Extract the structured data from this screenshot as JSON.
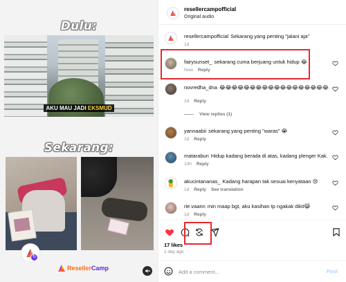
{
  "media": {
    "title_top": "Dulu:",
    "caption_top_prefix": "AKU MAU JADI ",
    "caption_top_highlight": "EKSMUD",
    "title_bottom": "Sekarang:",
    "brand_part1": "Reseller",
    "brand_part2": "Camp"
  },
  "header": {
    "account_name": "resellercampofficial",
    "audio_label": "Original audio"
  },
  "caption": {
    "username": "resellercampofficial",
    "text": "Sekarang yang penting \"jalani aja\"",
    "time": "1d"
  },
  "comments": [
    {
      "username": "fairysunset_",
      "text": "sekarang cuma berjuang untuk hidup 😂",
      "time": "Now",
      "reply": "Reply"
    },
    {
      "username": "novredha_dna",
      "text": "😂😂😂😂😂😂😂😂😂😂😂😂😂😂😂😂😂😂",
      "time": "1d",
      "reply": "Reply",
      "view_replies": "View replies (1)"
    },
    {
      "username": "yannaabii",
      "text": "sekarang yang penting \"waras\" 😭",
      "time": "1d",
      "reply": "Reply"
    },
    {
      "username": "matarabun",
      "text": "Hidup kadang berada di atas, kadang plenger Kak.",
      "time": "10h",
      "reply": "Reply"
    },
    {
      "username": "akucintananas_",
      "text": "Kadang harapan tak sesuai kenyataan 😢",
      "time": "1d",
      "reply": "Reply",
      "translate": "See translation"
    },
    {
      "username": "rie.vaann",
      "text": "min maap bgt, aku kasihan tp ngakak dikit😹",
      "time": "1d",
      "reply": "Reply"
    }
  ],
  "footer": {
    "likes": "17 likes",
    "time_ago": "1 day ago",
    "add_comment_placeholder": "Add a comment...",
    "post_label": "Post"
  },
  "colors": {
    "highlight_border": "#e8262c",
    "like_red": "#ff3040",
    "brand_orange": "#ff6a1a",
    "brand_purple": "#5a2ac7",
    "post_disabled": "#b3d4fc"
  }
}
